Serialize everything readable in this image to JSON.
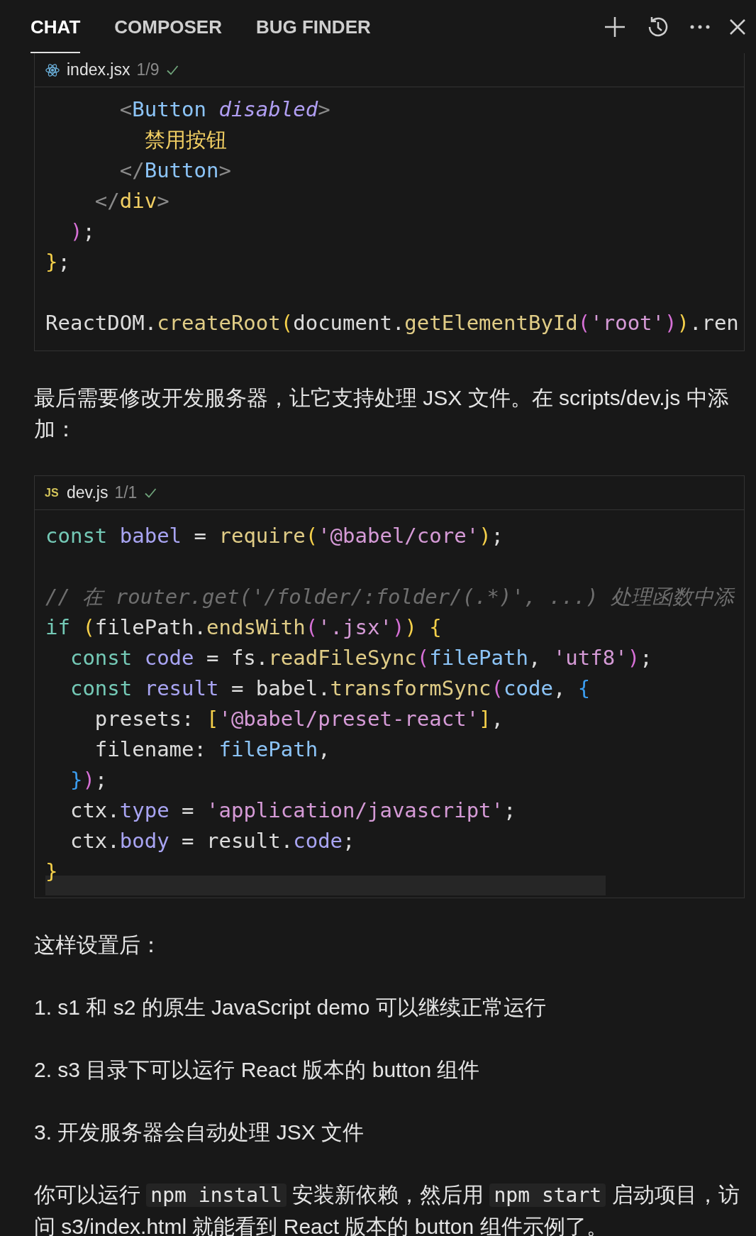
{
  "tabs": [
    {
      "label": "CHAT",
      "selected": true
    },
    {
      "label": "COMPOSER",
      "selected": false
    },
    {
      "label": "BUG FINDER",
      "selected": false
    }
  ],
  "blocks": [
    {
      "kind": "code",
      "file": {
        "name": "index.jsx",
        "count": "1/9"
      },
      "lines": [
        {
          "kind": "code",
          "tokens": [
            {
              "kind": "gt",
              "text": "      <"
            },
            {
              "kind": "tag",
              "text": "Button "
            },
            {
              "kind": "attr",
              "text": "disabled"
            },
            {
              "kind": "gt",
              "text": ">"
            }
          ]
        },
        {
          "kind": "code",
          "tokens": [
            {
              "kind": "jsx",
              "text": "        禁用按钮"
            }
          ]
        },
        {
          "kind": "code",
          "tokens": [
            {
              "kind": "gt",
              "text": "      </"
            },
            {
              "kind": "tag",
              "text": "Button"
            },
            {
              "kind": "gt",
              "text": ">"
            }
          ]
        },
        {
          "kind": "code",
          "tokens": [
            {
              "kind": "gt",
              "text": "    </"
            },
            {
              "kind": "jsx",
              "text": "div"
            },
            {
              "kind": "gt",
              "text": ">"
            }
          ]
        },
        {
          "kind": "code",
          "tokens": [
            {
              "kind": "m",
              "text": "  )"
            },
            {
              "kind": "p",
              "text": ";"
            }
          ]
        },
        {
          "kind": "code",
          "tokens": [
            {
              "kind": "y",
              "text": "}"
            },
            {
              "kind": "p",
              "text": ";"
            }
          ]
        },
        {
          "kind": "blank"
        },
        {
          "kind": "code",
          "tokens": [
            {
              "kind": "p",
              "text": "ReactDOM."
            },
            {
              "kind": "fn",
              "text": "createRoot"
            },
            {
              "kind": "y",
              "text": "("
            },
            {
              "kind": "p",
              "text": "document."
            },
            {
              "kind": "fn",
              "text": "getElementById"
            },
            {
              "kind": "m",
              "text": "("
            },
            {
              "kind": "str",
              "text": "'root'"
            },
            {
              "kind": "m",
              "text": ")"
            },
            {
              "kind": "y",
              "text": ")"
            },
            {
              "kind": "p",
              "text": ".ren"
            }
          ]
        }
      ]
    },
    {
      "kind": "text",
      "segments": [
        {
          "kind": "text",
          "text": "最后需要修改开发服务器，让它支持处理 JSX 文件。在 scripts/dev.js 中添加："
        }
      ]
    },
    {
      "kind": "code",
      "file": {
        "icon_text": "JS",
        "name": "dev.js",
        "count": "1/1"
      },
      "lines": [
        {
          "kind": "code",
          "tokens": [
            {
              "kind": "kw",
              "text": "const "
            },
            {
              "kind": "var",
              "text": "babel"
            },
            {
              "kind": "p",
              "text": " = "
            },
            {
              "kind": "fn",
              "text": "require"
            },
            {
              "kind": "y",
              "text": "("
            },
            {
              "kind": "str",
              "text": "'@babel/core'"
            },
            {
              "kind": "y",
              "text": ")"
            },
            {
              "kind": "p",
              "text": ";"
            }
          ]
        },
        {
          "kind": "blank"
        },
        {
          "kind": "code",
          "tokens": [
            {
              "kind": "cm",
              "text": "// 在 router.get('/folder/:folder/(.*)', ...) 处理函数中添"
            }
          ]
        },
        {
          "kind": "code",
          "tokens": [
            {
              "kind": "kw",
              "text": "if "
            },
            {
              "kind": "y",
              "text": "("
            },
            {
              "kind": "p",
              "text": "filePath."
            },
            {
              "kind": "fn",
              "text": "endsWith"
            },
            {
              "kind": "m",
              "text": "("
            },
            {
              "kind": "str",
              "text": "'.jsx'"
            },
            {
              "kind": "m",
              "text": ")"
            },
            {
              "kind": "y",
              "text": ")"
            },
            {
              "kind": "y",
              "text": " {"
            }
          ]
        },
        {
          "kind": "code",
          "tokens": [
            {
              "kind": "kw",
              "text": "  const "
            },
            {
              "kind": "var",
              "text": "code"
            },
            {
              "kind": "p",
              "text": " = fs."
            },
            {
              "kind": "fn",
              "text": "readFileSync"
            },
            {
              "kind": "m",
              "text": "("
            },
            {
              "kind": "tag",
              "text": "filePath"
            },
            {
              "kind": "p",
              "text": ", "
            },
            {
              "kind": "str",
              "text": "'utf8'"
            },
            {
              "kind": "m",
              "text": ")"
            },
            {
              "kind": "p",
              "text": ";"
            }
          ]
        },
        {
          "kind": "code",
          "tokens": [
            {
              "kind": "kw",
              "text": "  const "
            },
            {
              "kind": "var",
              "text": "result"
            },
            {
              "kind": "p",
              "text": " = babel."
            },
            {
              "kind": "fn",
              "text": "transformSync"
            },
            {
              "kind": "m",
              "text": "("
            },
            {
              "kind": "tag",
              "text": "code"
            },
            {
              "kind": "p",
              "text": ", "
            },
            {
              "kind": "b",
              "text": "{"
            }
          ]
        },
        {
          "kind": "code",
          "tokens": [
            {
              "kind": "p",
              "text": "    presets: "
            },
            {
              "kind": "y",
              "text": "["
            },
            {
              "kind": "str",
              "text": "'@babel/preset-react'"
            },
            {
              "kind": "y",
              "text": "]"
            },
            {
              "kind": "p",
              "text": ","
            }
          ]
        },
        {
          "kind": "code",
          "tokens": [
            {
              "kind": "p",
              "text": "    filename: "
            },
            {
              "kind": "tag",
              "text": "filePath"
            },
            {
              "kind": "p",
              "text": ","
            }
          ]
        },
        {
          "kind": "code",
          "tokens": [
            {
              "kind": "b",
              "text": "  }"
            },
            {
              "kind": "m",
              "text": ")"
            },
            {
              "kind": "p",
              "text": ";"
            }
          ]
        },
        {
          "kind": "code",
          "tokens": [
            {
              "kind": "p",
              "text": "  ctx."
            },
            {
              "kind": "var",
              "text": "type"
            },
            {
              "kind": "p",
              "text": " = "
            },
            {
              "kind": "str",
              "text": "'application/javascript'"
            },
            {
              "kind": "p",
              "text": ";"
            }
          ]
        },
        {
          "kind": "code",
          "tokens": [
            {
              "kind": "p",
              "text": "  ctx."
            },
            {
              "kind": "var",
              "text": "body"
            },
            {
              "kind": "p",
              "text": " = result."
            },
            {
              "kind": "var",
              "text": "code"
            },
            {
              "kind": "p",
              "text": ";"
            }
          ]
        },
        {
          "kind": "code",
          "tokens": [
            {
              "kind": "y",
              "text": "}"
            }
          ]
        }
      ]
    },
    {
      "kind": "text",
      "segments": [
        {
          "kind": "text",
          "text": "这样设置后："
        }
      ]
    },
    {
      "kind": "text",
      "segments": [
        {
          "kind": "text",
          "text": "1. s1 和 s2 的原生 JavaScript demo 可以继续正常运行"
        }
      ]
    },
    {
      "kind": "text",
      "segments": [
        {
          "kind": "text",
          "text": "2. s3 目录下可以运行 React 版本的 button 组件"
        }
      ]
    },
    {
      "kind": "text",
      "segments": [
        {
          "kind": "text",
          "text": "3. 开发服务器会自动处理 JSX 文件"
        }
      ]
    },
    {
      "kind": "text",
      "segments": [
        {
          "kind": "text",
          "text": "你可以运行 "
        },
        {
          "kind": "code",
          "text": "npm install"
        },
        {
          "kind": "text",
          "text": " 安装新依赖，然后用 "
        },
        {
          "kind": "code",
          "text": "npm start"
        },
        {
          "kind": "text",
          "text": " 启动项目，访问 s3/index.html 就能看到 React 版本的 button 组件示例了。"
        }
      ]
    }
  ]
}
